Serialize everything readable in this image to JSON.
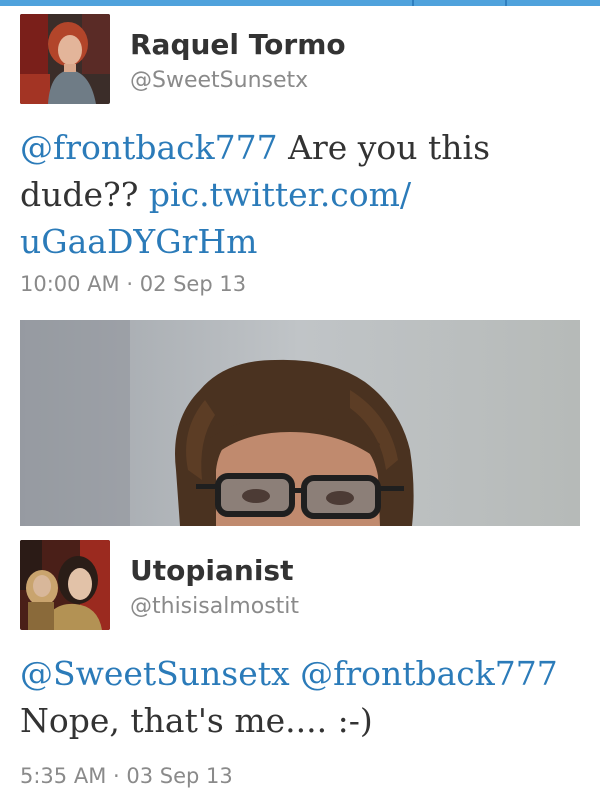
{
  "tweets": [
    {
      "name": "Raquel Tormo",
      "handle": "@SweetSunsetx",
      "text": [
        {
          "t": "@frontback777",
          "link": true
        },
        {
          "t": " Are you this dude?? ",
          "link": false
        },
        {
          "t": "pic.twitter.com/",
          "link": true
        },
        {
          "t": "uGaaDYGrHm",
          "link": true
        }
      ],
      "time": "10:00 AM · 02 Sep 13"
    },
    {
      "name": "Utopianist",
      "handle": "@thisisalmostit",
      "text": [
        {
          "t": "@SweetSunsetx",
          "link": true
        },
        {
          "t": " ",
          "link": false
        },
        {
          "t": "@frontback777",
          "link": true
        },
        {
          "t": " Nope, that's me.... :-)",
          "link": false
        }
      ],
      "time": "5:35 AM · 03 Sep 13"
    }
  ],
  "colors": {
    "link": "#2b7bb9",
    "text": "#333333",
    "muted": "#8a8a8a",
    "accent_bar": "#4fa2dc"
  }
}
